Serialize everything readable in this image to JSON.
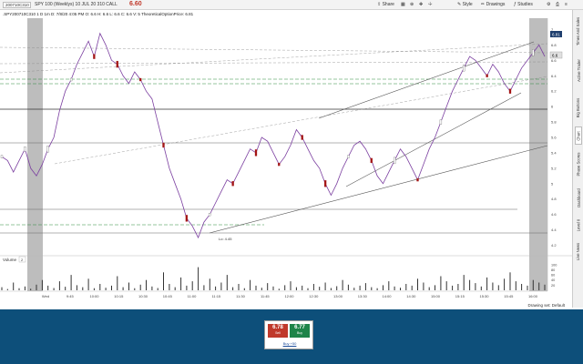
{
  "toolbar": {
    "symbol": "200710C310",
    "description": "SPY 100 (Weeklys) 10 JUL 20 310 CALL",
    "last_price": "6.60",
    "share_label": "Share",
    "style_label": "Style",
    "drawings_label": "Drawings",
    "studies_label": "Studies"
  },
  "infobar": {
    "text": ".SPY200710C310 1 D 1m   D: 7/8/20 4:05 PM  O: 6.6  H: 6.6  L: 6.6  C: 6.6  V: 5  TheoreticalOptionPrice: 6.81"
  },
  "right_tabs": [
    "Times And Sales",
    "Active Trader",
    "Big Buttons",
    "Chart",
    "Phase Scores",
    "Dashboard",
    "Level II",
    "Live News"
  ],
  "chart_data": {
    "type": "line",
    "x_ticks": [
      "Wed",
      "9:45",
      "10:00",
      "10:15",
      "10:30",
      "10:45",
      "11:00",
      "11:15",
      "11:30",
      "11:45",
      "12:00",
      "12:30",
      "13:00",
      "13:30",
      "14:00",
      "14:30",
      "15:00",
      "15:15",
      "15:30",
      "15:45",
      "16:00"
    ],
    "price_ticks": [
      "7",
      "6.8",
      "6.6",
      "6.4",
      "6.2",
      "6",
      "5.8",
      "5.6",
      "5.4",
      "5.2",
      "5",
      "4.8",
      "4.6",
      "4.4",
      "4.2"
    ],
    "ylim": [
      4.1,
      7.1
    ],
    "volume_ticks": [
      "100",
      "80",
      "60",
      "40",
      "20"
    ],
    "volume_ylim": [
      0,
      110
    ],
    "price_labels": [
      "6.81",
      "6.6"
    ],
    "low_label": "Lo: 4.45",
    "volume_label": "Volume",
    "volume_tab": "2",
    "candles": [
      5.35,
      5.3,
      5.15,
      5.3,
      5.45,
      5.2,
      5.1,
      5.25,
      5.45,
      5.6,
      5.95,
      6.2,
      6.35,
      6.55,
      6.7,
      6.85,
      6.65,
      6.95,
      6.8,
      6.6,
      6.55,
      6.4,
      6.3,
      6.45,
      6.35,
      6.2,
      6.1,
      5.8,
      5.5,
      5.2,
      5.0,
      4.8,
      4.55,
      4.45,
      4.3,
      4.5,
      4.6,
      4.75,
      4.9,
      5.05,
      5.0,
      5.15,
      5.3,
      5.45,
      5.4,
      5.6,
      5.55,
      5.4,
      5.25,
      5.35,
      5.5,
      5.7,
      5.6,
      5.45,
      5.3,
      5.2,
      5.0,
      4.85,
      5.0,
      5.2,
      5.35,
      5.5,
      5.55,
      5.45,
      5.3,
      5.1,
      5.0,
      5.15,
      5.3,
      5.45,
      5.35,
      5.2,
      5.05,
      5.25,
      5.45,
      5.6,
      5.8,
      6.0,
      6.2,
      6.35,
      6.5,
      6.65,
      6.6,
      6.5,
      6.4,
      6.55,
      6.45,
      6.3,
      6.2,
      6.35,
      6.5,
      6.6,
      6.7,
      6.8,
      6.65
    ],
    "volumes": [
      12,
      5,
      30,
      8,
      15,
      6,
      22,
      40,
      18,
      9,
      35,
      14,
      60,
      20,
      12,
      45,
      8,
      25,
      10,
      18,
      55,
      12,
      30,
      8,
      22,
      40,
      15,
      9,
      70,
      25,
      12,
      50,
      18,
      35,
      90,
      20,
      45,
      15,
      30,
      60,
      12,
      25,
      8,
      40,
      18,
      10,
      28,
      15,
      6,
      20,
      35,
      12,
      18,
      8,
      25,
      14,
      30,
      9,
      16,
      40,
      22,
      10,
      18,
      28,
      12,
      8,
      20,
      35,
      15,
      10,
      25,
      18,
      45,
      30,
      12,
      20,
      55,
      35,
      18,
      25,
      60,
      40,
      28,
      15,
      50,
      30,
      20,
      45,
      70,
      35,
      25,
      18,
      40,
      30,
      22
    ]
  },
  "drawing_set": "Drawing set: Default",
  "trade_widget": {
    "sell_price": "6.78",
    "sell_label": "Sell",
    "buy_price": "6.77",
    "buy_label": "Buy",
    "link": "Buy +50"
  }
}
